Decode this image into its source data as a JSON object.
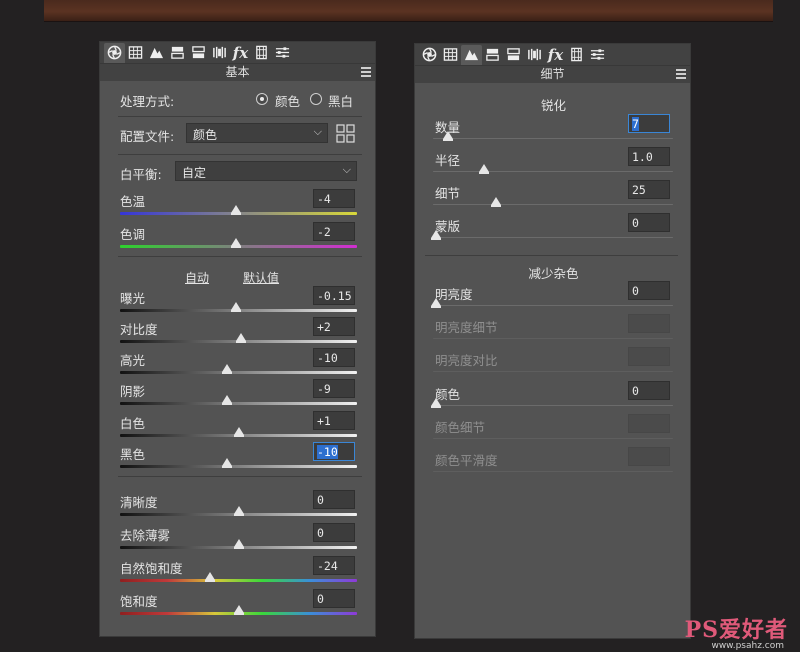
{
  "left_panel": {
    "title": "基本",
    "process": {
      "label": "处理方式:",
      "options": [
        "颜色",
        "黑白"
      ],
      "selected": "颜色"
    },
    "profile": {
      "label": "配置文件:",
      "value": "颜色"
    },
    "white_balance": {
      "label": "白平衡:",
      "value": "自定"
    },
    "auto_label": "自动",
    "default_label": "默认值",
    "sliders": [
      {
        "label": "色温",
        "value": "-4",
        "level": 0.49
      },
      {
        "label": "色调",
        "value": "-2",
        "level": 0.49
      },
      {
        "label": "曝光",
        "value": "-0.15",
        "level": 0.49
      },
      {
        "label": "对比度",
        "value": "+2",
        "level": 0.51
      },
      {
        "label": "高光",
        "value": "-10",
        "level": 0.45
      },
      {
        "label": "阴影",
        "value": "-9",
        "level": 0.45
      },
      {
        "label": "白色",
        "value": "+1",
        "level": 0.5
      },
      {
        "label": "黑色",
        "value": "-10",
        "level": 0.45
      },
      {
        "label": "清晰度",
        "value": "0",
        "level": 0.5
      },
      {
        "label": "去除薄雾",
        "value": "0",
        "level": 0.5
      },
      {
        "label": "自然饱和度",
        "value": "-24",
        "level": 0.38
      },
      {
        "label": "饱和度",
        "value": "0",
        "level": 0.5
      }
    ]
  },
  "right_panel": {
    "title": "细节",
    "sharpen_title": "锐化",
    "noise_title": "减少杂色",
    "sharpen": [
      {
        "label": "数量",
        "value": "7",
        "level": 0.05
      },
      {
        "label": "半径",
        "value": "1.0",
        "level": 0.2
      },
      {
        "label": "细节",
        "value": "25",
        "level": 0.25
      },
      {
        "label": "蒙版",
        "value": "0",
        "level": 0.0
      }
    ],
    "noise": [
      {
        "label": "明亮度",
        "value": "0",
        "level": 0.0,
        "enabled": true
      },
      {
        "label": "明亮度细节",
        "value": "",
        "enabled": false
      },
      {
        "label": "明亮度对比",
        "value": "",
        "enabled": false
      },
      {
        "label": "颜色",
        "value": "0",
        "level": 0.0,
        "enabled": true
      },
      {
        "label": "颜色细节",
        "value": "",
        "enabled": false
      },
      {
        "label": "颜色平滑度",
        "value": "",
        "enabled": false
      }
    ]
  },
  "tabs": [
    "aperture-icon",
    "histogram-icon",
    "mountains-icon",
    "split-toning-icon",
    "hsl-icon",
    "lens-icon",
    "fx-icon",
    "camera-calibration-icon",
    "sliders-icon"
  ],
  "watermark": {
    "main": "PS爱好者",
    "sub": "www.psahz.com"
  },
  "colors": {
    "panel": "#535353",
    "field": "#3c3c3c",
    "accent": "#2d6fcf"
  }
}
